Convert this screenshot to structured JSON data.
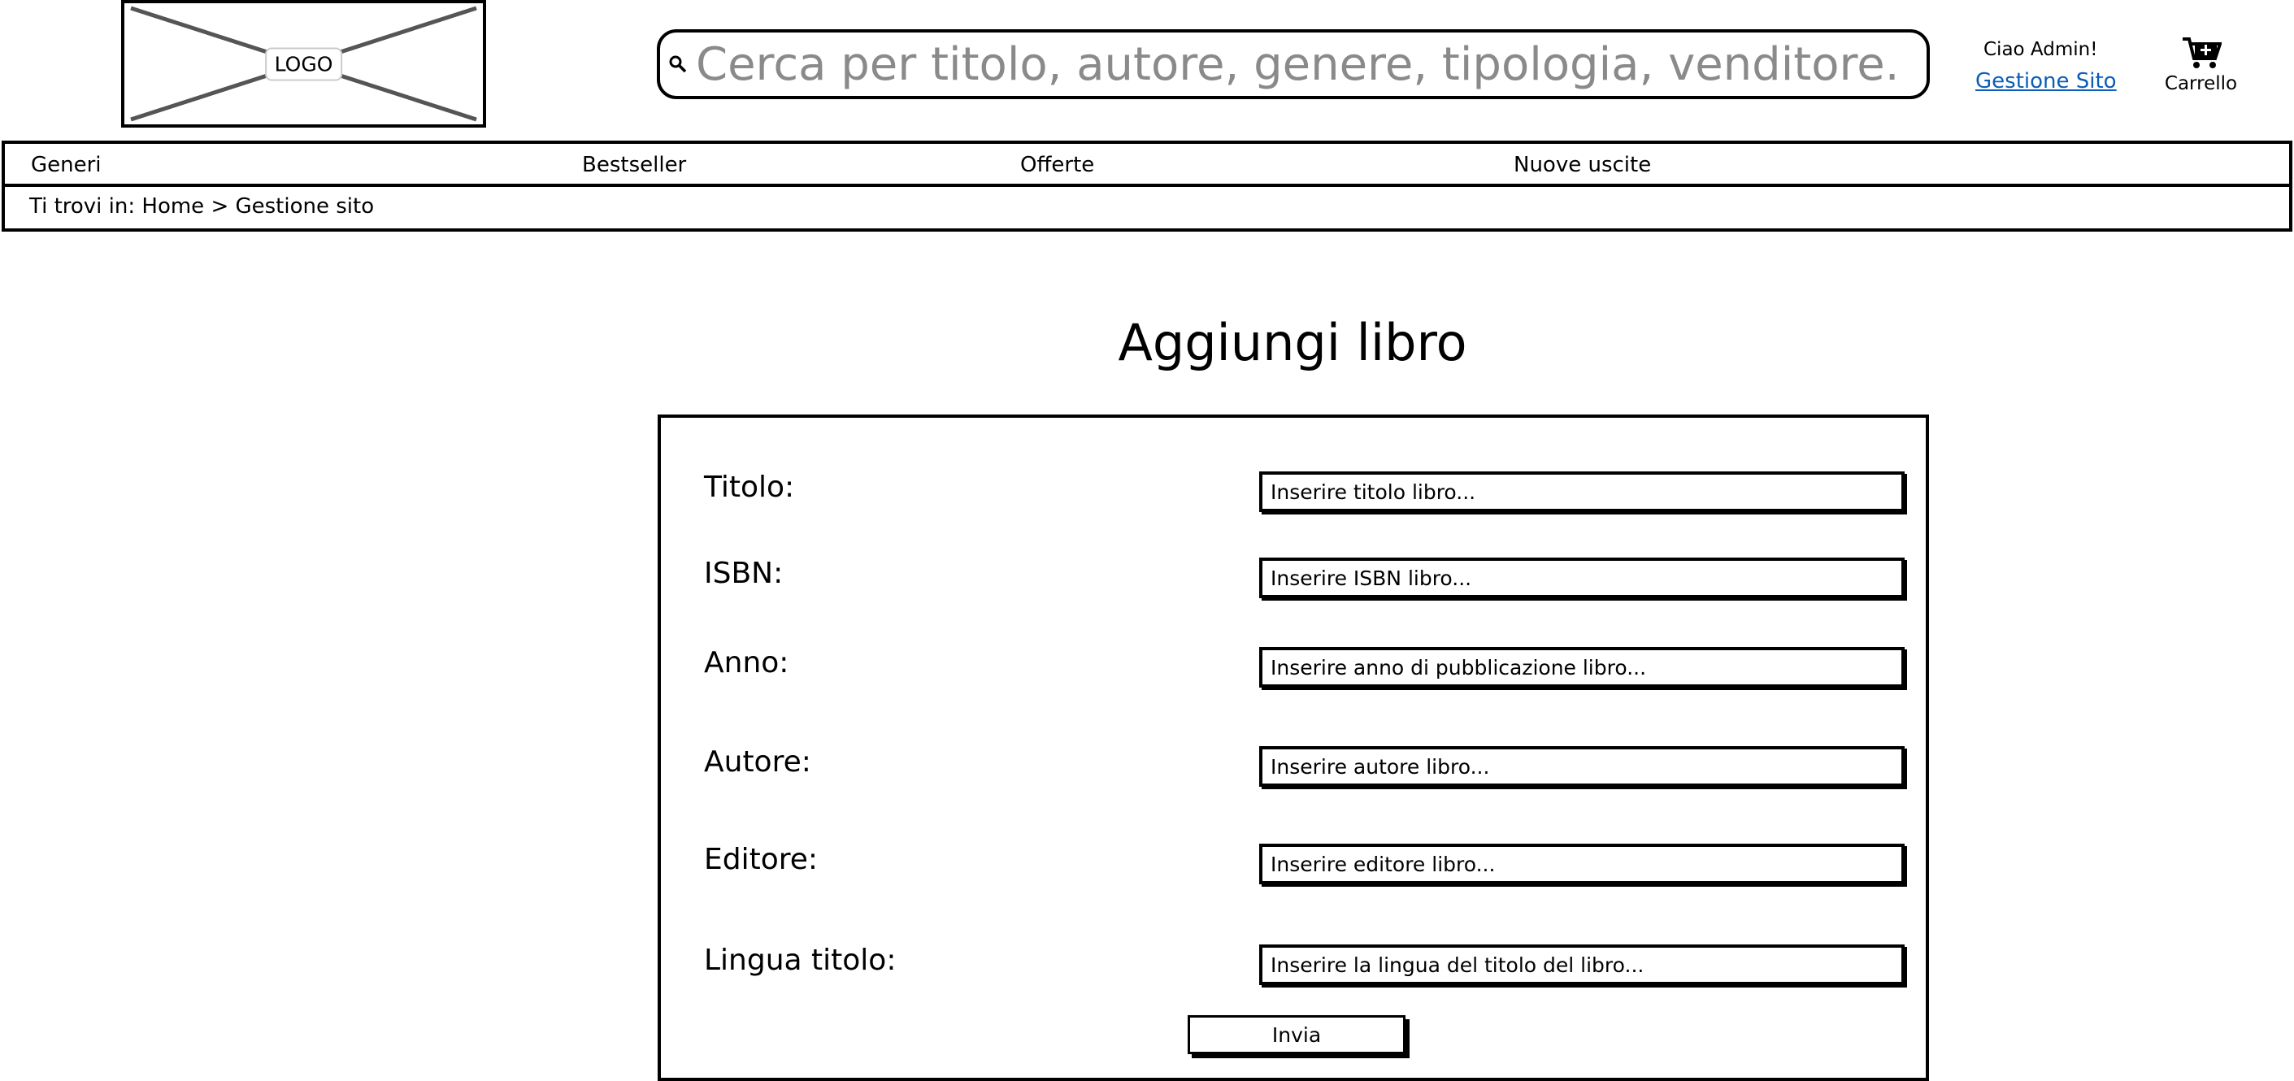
{
  "header": {
    "logo_label": "LOGO",
    "search_placeholder": "Cerca per titolo, autore, genere, tipologia, venditore...",
    "greeting": "Ciao Admin!",
    "admin_link": "Gestione Sito",
    "cart_label": "Carrello"
  },
  "nav": {
    "items": [
      "Generi",
      "Bestseller",
      "Offerte",
      "Nuove uscite"
    ]
  },
  "breadcrumb": "Ti trovi in: Home > Gestione sito",
  "page_title": "Aggiungi libro",
  "form": {
    "fields": [
      {
        "label": "Titolo:",
        "placeholder": "Inserire titolo libro..."
      },
      {
        "label": "ISBN:",
        "placeholder": "Inserire ISBN libro..."
      },
      {
        "label": "Anno:",
        "placeholder": "Inserire anno di pubblicazione libro..."
      },
      {
        "label": "Autore:",
        "placeholder": "Inserire autore libro..."
      },
      {
        "label": "Editore:",
        "placeholder": "Inserire editore libro..."
      },
      {
        "label": "Lingua titolo:",
        "placeholder": "Inserire la lingua del titolo del libro..."
      }
    ],
    "submit_label": "Invia"
  }
}
